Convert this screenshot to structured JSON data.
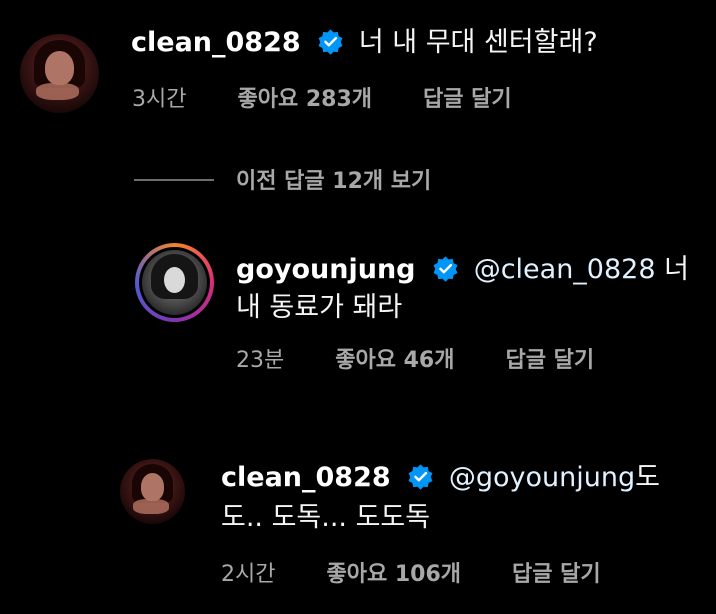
{
  "comments": [
    {
      "username": "clean_0828",
      "text": "너 내 무대 센터할래?",
      "time": "3시간",
      "likes": "좋아요 283개",
      "reply": "답글 달기"
    },
    {
      "username": "goyounjung",
      "mention": "@clean_0828",
      "text_line1_tail": " 너",
      "text_line2": "내 동료가 돼라",
      "time": "23분",
      "likes": "좋아요 46개",
      "reply": "답글 달기"
    },
    {
      "username": "clean_0828",
      "mention": "@goyounjung",
      "text_line1_tail": "도",
      "text_line2": "도.. 도독... 도도독",
      "time": "2시간",
      "likes": "좋아요 106개",
      "reply": "답글 달기"
    }
  ],
  "view_previous_replies": "이전 답글 12개 보기",
  "colors": {
    "background": "#000000",
    "text": "#f5f5f5",
    "secondary_text": "#a8a8a8",
    "verified_badge": "#0095f6"
  },
  "icons": [
    "verified-badge-icon"
  ]
}
